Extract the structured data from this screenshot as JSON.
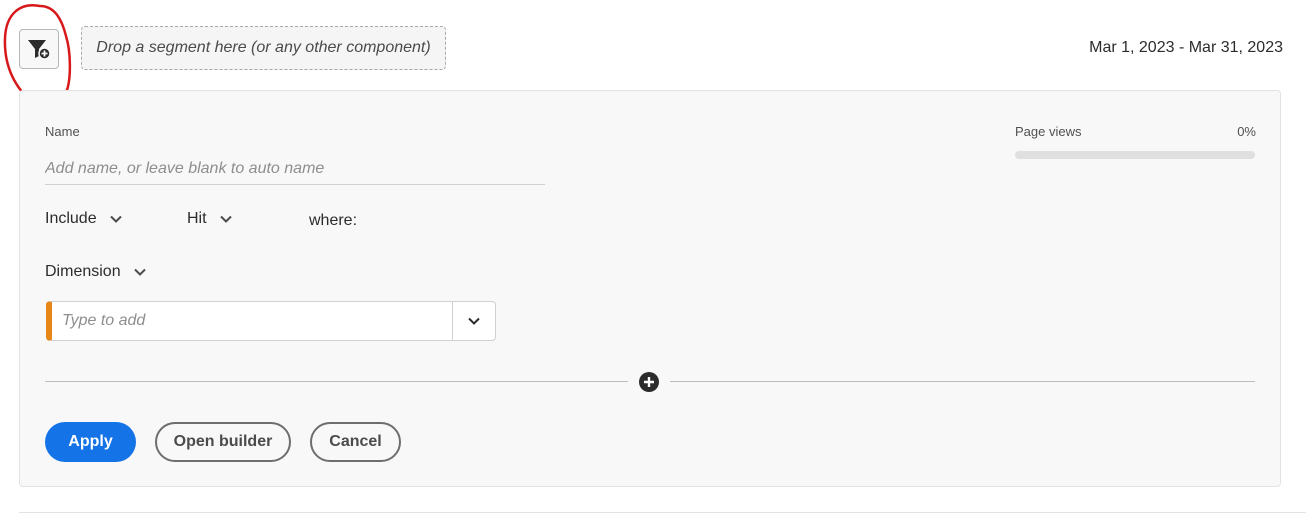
{
  "toolbar": {
    "filter_icon": "filter-add-icon",
    "drop_zone_text": "Drop a segment here (or any other component)",
    "date_range": "Mar 1, 2023 - Mar 31, 2023"
  },
  "segment_form": {
    "name_label": "Name",
    "name_placeholder": "Add name, or leave blank to auto name",
    "name_value": "",
    "include_label": "Include",
    "hit_label": "Hit",
    "where_label": "where:",
    "dimension_label": "Dimension",
    "dimension_placeholder": "Type to add",
    "add_rule_icon": "plus-circle-icon"
  },
  "metric": {
    "label": "Page views",
    "value": "0%",
    "fraction": 0
  },
  "actions": {
    "apply_label": "Apply",
    "open_builder_label": "Open builder",
    "cancel_label": "Cancel"
  },
  "colors": {
    "primary": "#1473e6",
    "dimension_accent": "#e68619",
    "annotation": "#d7191c"
  }
}
